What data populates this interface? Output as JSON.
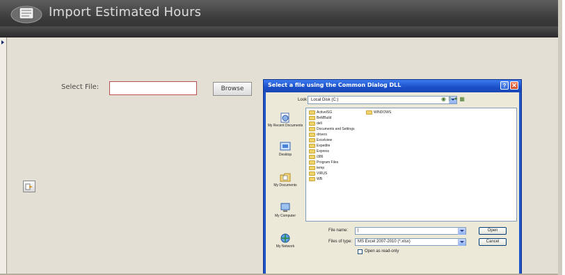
{
  "header": {
    "title": "Import Estimated Hours"
  },
  "form": {
    "select_label": "Select File:",
    "file_value": "",
    "browse_label": "Browse"
  },
  "dialog": {
    "title": "Select a file using the Common Dialog DLL",
    "help_label": "?",
    "close_label": "✕",
    "look_in_label": "Look in:",
    "look_in_value": "Local Disk (C:)",
    "places": [
      "My Recent Documents",
      "Desktop",
      "My Documents",
      "My Computer",
      "My Network"
    ],
    "folders_col1": [
      "ActiveISG",
      "BeMBuild",
      "dell",
      "Documents and Settings",
      "drivers",
      "Excelview",
      "Expedite",
      "Express",
      "i386",
      "Program Files",
      "temp",
      "VIRUS",
      "WB"
    ],
    "folders_col2": [
      "WINDOWS"
    ],
    "file_name_label": "File name:",
    "file_name_value": "|",
    "file_type_label": "Files of type:",
    "file_type_value": "MS Excel 2007-2010 (*.xlsx)",
    "open_label": "Open",
    "cancel_label": "Cancel",
    "readonly_label": "Open as read-only"
  },
  "colors": {
    "titlebar": "#3b3b3b",
    "background": "#e4dfd4",
    "dialog_blue": "#1f55c7"
  }
}
